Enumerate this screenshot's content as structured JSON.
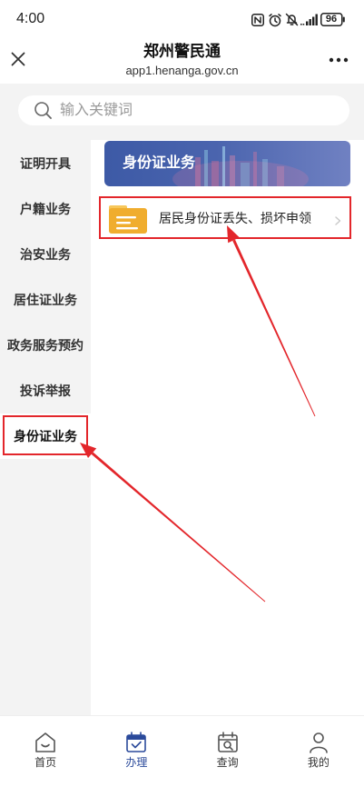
{
  "status_bar": {
    "time": "4:00",
    "battery": "96",
    "icons": [
      "nfc-icon",
      "alarm-icon",
      "mute-icon",
      "signal-icon",
      "battery-icon"
    ]
  },
  "header": {
    "title": "郑州警民通",
    "subtitle": "app1.henanga.gov.cn",
    "left_icon": "close-icon",
    "right_icon": "more-icon"
  },
  "search": {
    "placeholder": "输入关键词",
    "icon": "search-icon"
  },
  "sidebar": {
    "items": [
      {
        "label": "证明开具"
      },
      {
        "label": "户籍业务"
      },
      {
        "label": "治安业务"
      },
      {
        "label": "居住证业务"
      },
      {
        "label": "政务服务预约"
      },
      {
        "label": "投诉举报"
      },
      {
        "label": "身份证业务",
        "selected": true
      }
    ]
  },
  "content": {
    "banner_title": "身份证业务",
    "items": [
      {
        "label": "居民身份证丢失、损坏申领",
        "icon": "document-icon",
        "trailing_icon": "chevron-right-icon"
      }
    ]
  },
  "tabbar": {
    "items": [
      {
        "label": "首页",
        "icon": "home-icon"
      },
      {
        "label": "办理",
        "icon": "calendar-check-icon",
        "active": true
      },
      {
        "label": "查询",
        "icon": "calendar-search-icon"
      },
      {
        "label": "我的",
        "icon": "user-icon"
      }
    ]
  },
  "colors": {
    "accent": "#2b4a9b",
    "annotation": "#e3262b",
    "sidebar_bg": "#f3f3f3",
    "banner_start": "#3d5aa6",
    "banner_end": "#7081c2",
    "document_icon": "#f0ad2e"
  }
}
